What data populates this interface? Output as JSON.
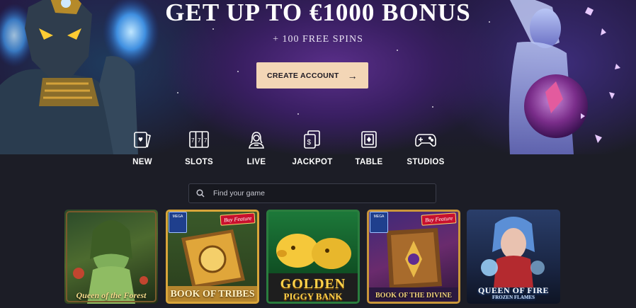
{
  "hero": {
    "title": "GET UP TO €1000 BONUS",
    "subtitle": "+ 100 FREE SPINS",
    "cta_label": "CREATE ACCOUNT",
    "cta_arrow": "→"
  },
  "categories": [
    {
      "label": "NEW",
      "icon": "new-cards-icon"
    },
    {
      "label": "SLOTS",
      "icon": "slot-reels-icon"
    },
    {
      "label": "LIVE",
      "icon": "live-dealer-icon"
    },
    {
      "label": "JACKPOT",
      "icon": "jackpot-icon"
    },
    {
      "label": "TABLE",
      "icon": "table-card-icon"
    },
    {
      "label": "STUDIOS",
      "icon": "gamepad-icon"
    }
  ],
  "search": {
    "placeholder": "Find your game",
    "icon": "search-icon"
  },
  "games": [
    {
      "title": "Queen of the Forest"
    },
    {
      "title": "BOOK OF TRIBES",
      "badge": "Buy Feature",
      "provider_badge": "MEGA"
    },
    {
      "title_line1": "GOLDEN",
      "title_line2": "PIGGY BANK"
    },
    {
      "title": "BOOK OF THE DIVINE",
      "badge": "Buy Feature",
      "provider_badge": "MEGA"
    },
    {
      "title_line1": "QUEEN OF FIRE",
      "title_line2": "FROZEN FLAMES"
    }
  ],
  "colors": {
    "cta_bg": "#f3d6b6",
    "page_bg": "#1c1d26",
    "buy_badge": "#c8102e"
  }
}
